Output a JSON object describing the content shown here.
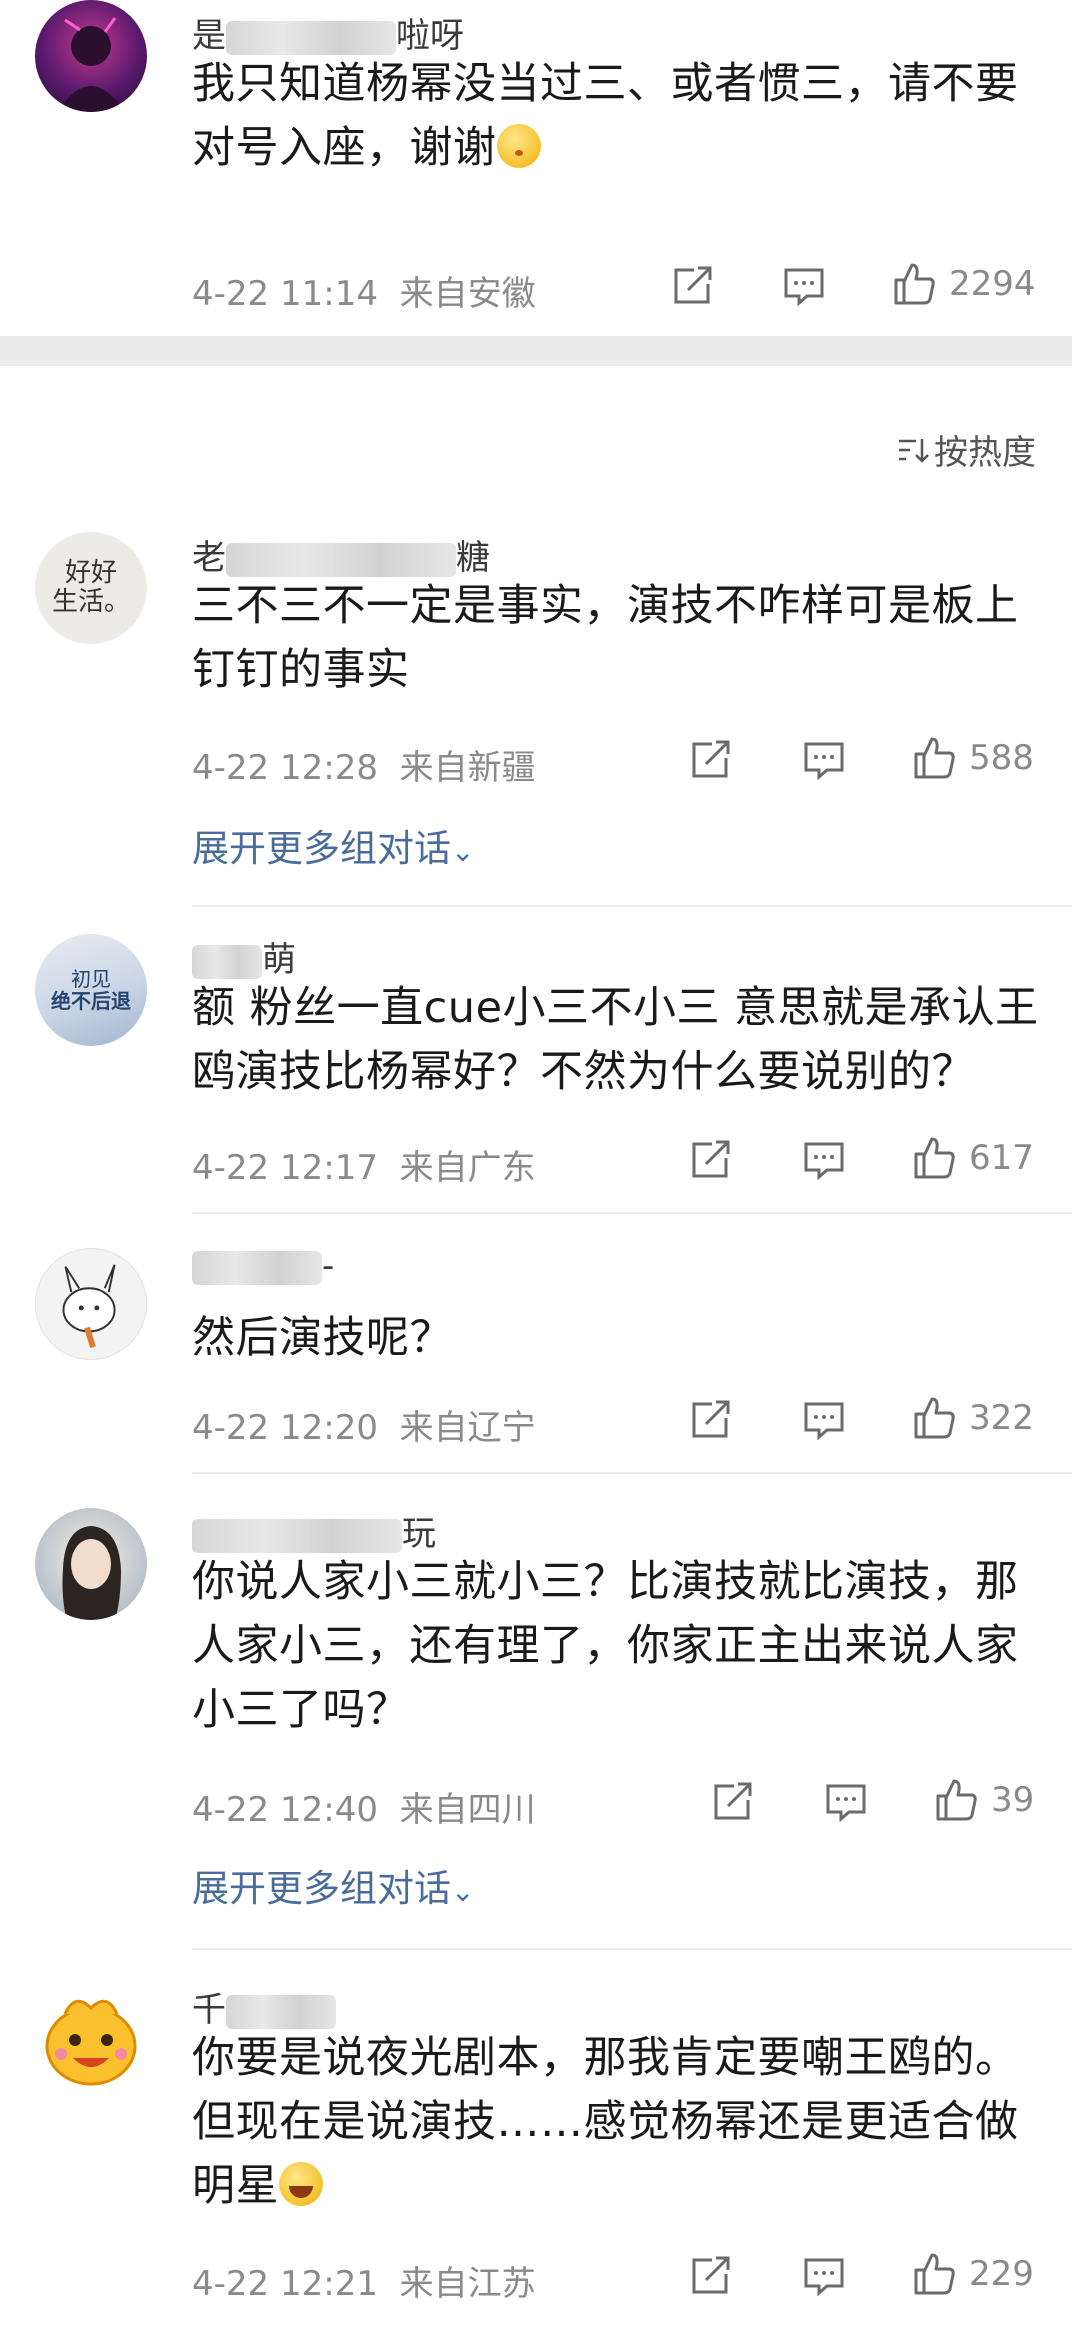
{
  "sort": {
    "label": "按热度"
  },
  "comments": [
    {
      "username_start": "是",
      "username_end": "啦呀",
      "text": "我只知道杨幂没当过三、或者惯三，请不要对号入座，谢谢",
      "emoji": "kiss-emoji",
      "time": "4-22 11:14",
      "location": "来自安徽",
      "likes": "2294",
      "expand": ""
    },
    {
      "username_start": "老",
      "username_end": "糖",
      "avatar_text": "好好\n生活。",
      "text": "三不三不一定是事实，演技不咋样可是板上钉钉的事实",
      "time": "4-22 12:28",
      "location": "来自新疆",
      "likes": "588",
      "expand": "展开更多组对话"
    },
    {
      "username_start": "",
      "username_end": "萌",
      "avatar_text": "初见\n绝不后退",
      "text": "额 粉丝一直cue小三不小三 意思就是承认王鸥演技比杨幂好？不然为什么要说别的？",
      "time": "4-22 12:17",
      "location": "来自广东",
      "likes": "617",
      "expand": ""
    },
    {
      "username_start": "",
      "username_end": "-",
      "text": "然后演技呢？",
      "time": "4-22 12:20",
      "location": "来自辽宁",
      "likes": "322",
      "expand": ""
    },
    {
      "username_start": "",
      "username_end": "玩",
      "text": "你说人家小三就小三？比演技就比演技，那人家小三，还有理了，你家正主出来说人家小三了吗？",
      "time": "4-22 12:40",
      "location": "来自四川",
      "likes": "39",
      "expand": "展开更多组对话"
    },
    {
      "username_start": "千",
      "username_end": "",
      "text": "你要是说夜光剧本，那我肯定要嘲王鸥的。但现在是说演技……感觉杨幂还是更适合做明星",
      "emoji": "laugh-emoji",
      "time": "4-22 12:21",
      "location": "来自江苏",
      "likes": "229",
      "expand": ""
    }
  ]
}
